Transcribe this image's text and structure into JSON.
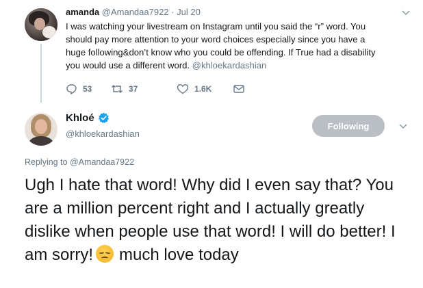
{
  "reply_tweet": {
    "author_name": "amanda",
    "author_handle": "@Amandaa7922",
    "separator": "·",
    "date": "Jul 20",
    "text_lines": [
      "I was watching your livestream on Instagram until you said the “r” word. You",
      "should pay more attention to your word choices especially since you have a",
      "huge following&don’t know who you could be offending.  If True had a disability",
      "would use a different word."
    ],
    "text_line4_prefix": "you",
    "mention": "@khloekardashian",
    "actions": {
      "replies": "53",
      "retweets": "37",
      "likes": "1.6K"
    },
    "avatar_icon": "profile-photo-avatar"
  },
  "main_tweet": {
    "author_name": "Khloé",
    "verified_icon": "verified-badge-icon",
    "author_handle": "@khloekardashian",
    "follow_button_label": "Following",
    "replying_to_prefix": "Replying to",
    "replying_to_handle": "@Amandaa7922",
    "text_before_emoji": "Ugh I hate that word! Why did I even say that? You are a million percent right and I actually greatly dislike when people use that word! I will do better! I am sorry!",
    "emoji": "disappointed-face-emoji",
    "text_after_emoji": "much love today",
    "avatar_icon": "profile-photo-avatar"
  },
  "colors": {
    "text_primary": "#14171a",
    "text_secondary": "#657786",
    "verified_blue": "#1da1f2",
    "following_button": "#b9bfc5",
    "thread_line": "#ccd6dd"
  }
}
